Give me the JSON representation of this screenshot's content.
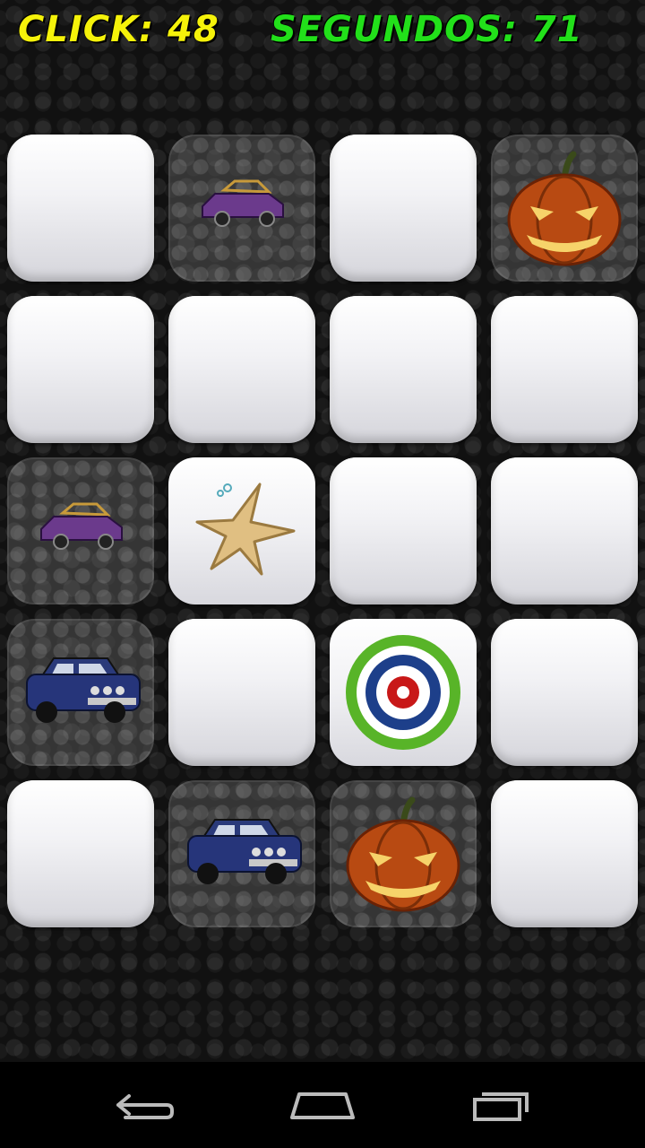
{
  "hud": {
    "clicks_text": "CLICK: 48",
    "seconds_text": "SEGUNDOS: 71"
  },
  "board": {
    "rows": 5,
    "cols": 4,
    "tiles": [
      [
        "hidden",
        "car-purple",
        "hidden",
        "pumpkin"
      ],
      [
        "hidden",
        "hidden",
        "hidden",
        "hidden"
      ],
      [
        "car-purple",
        "starfish",
        "hidden",
        "hidden"
      ],
      [
        "car-blue",
        "hidden",
        "target",
        "hidden"
      ],
      [
        "hidden",
        "car-blue",
        "pumpkin",
        "hidden"
      ]
    ]
  },
  "colors": {
    "clicks": "#f5f20a",
    "seconds": "#22e01a"
  },
  "navbar": {
    "icons": [
      "back-icon",
      "home-icon",
      "recent-apps-icon"
    ]
  }
}
